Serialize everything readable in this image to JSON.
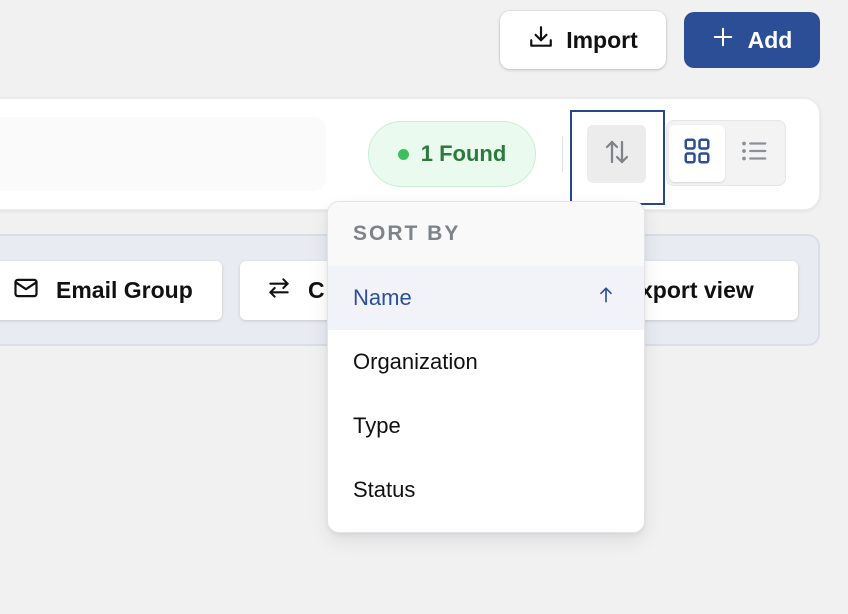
{
  "header": {
    "import_label": "Import",
    "add_label": "Add"
  },
  "toolbar": {
    "found_label": "1 Found"
  },
  "bulk_actions": {
    "email_group_label": "Email Group",
    "c_label": "C",
    "export_view_label": "xport view"
  },
  "sort_menu": {
    "title": "SORT BY",
    "items": [
      {
        "label": "Name",
        "active": true,
        "direction": "ascending"
      },
      {
        "label": "Organization",
        "active": false
      },
      {
        "label": "Type",
        "active": false
      },
      {
        "label": "Status",
        "active": false
      }
    ]
  },
  "colors": {
    "accent": "#2c4e97",
    "found_text": "#2c7a3e",
    "found_dot": "#3fbe5e",
    "active_item": "#2d4f98"
  },
  "icons": [
    "download-icon",
    "plus-icon",
    "sort-icon",
    "grid-view-icon",
    "list-view-icon",
    "mail-icon",
    "swap-icon",
    "arrow-up-icon"
  ]
}
